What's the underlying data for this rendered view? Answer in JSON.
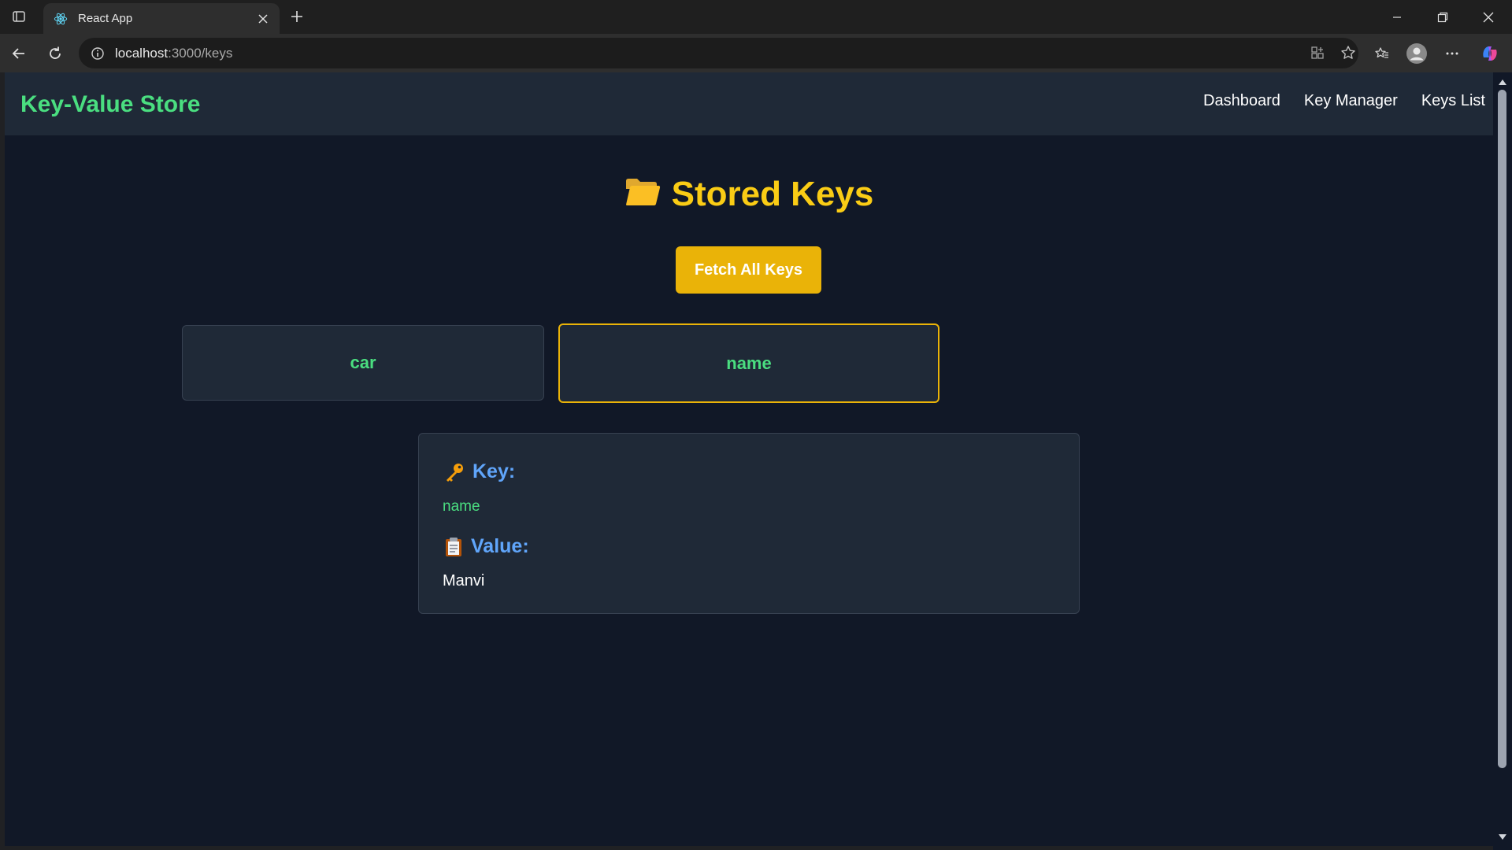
{
  "browser": {
    "tab_title": "React App",
    "url_host": "localhost",
    "url_path": ":3000/keys"
  },
  "navbar": {
    "brand": "Key-Value Store",
    "links": [
      "Dashboard",
      "Key Manager",
      "Keys List"
    ]
  },
  "page": {
    "title": "Stored Keys",
    "title_icon": "folder-icon",
    "fetch_button": "Fetch All Keys"
  },
  "keys": [
    {
      "name": "car",
      "selected": false
    },
    {
      "name": "name",
      "selected": true
    }
  ],
  "detail": {
    "key_label": "Key:",
    "key_icon": "key-icon",
    "key_value": "name",
    "value_label": "Value:",
    "value_icon": "clipboard-icon",
    "value_value": "Manvi"
  },
  "colors": {
    "brand_green": "#4ade80",
    "title_yellow": "#facc15",
    "button_yellow": "#eab308",
    "label_blue": "#60a5fa",
    "page_bg": "#111827",
    "card_bg": "#1f2937"
  }
}
